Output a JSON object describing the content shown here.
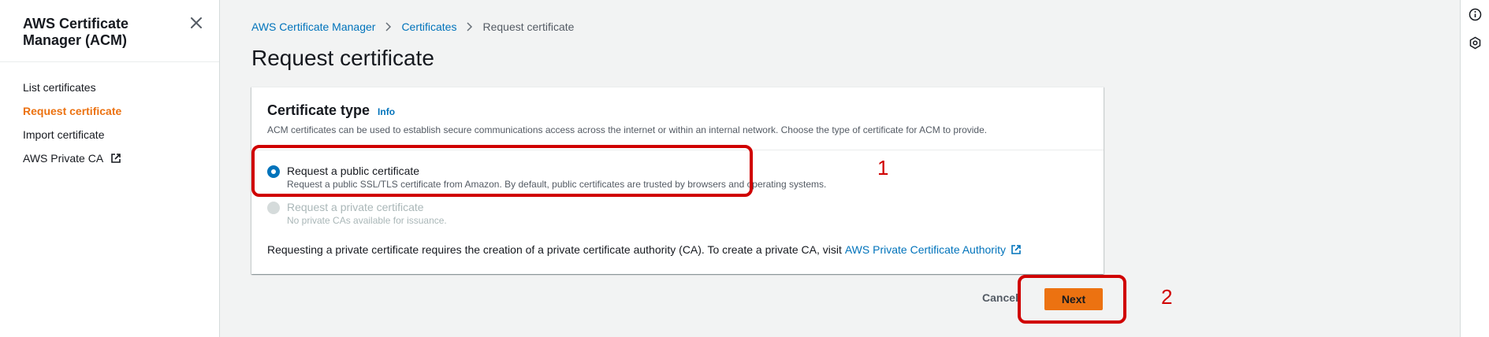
{
  "sidebar": {
    "title": "AWS Certificate Manager (ACM)",
    "items": [
      {
        "label": "List certificates"
      },
      {
        "label": "Request certificate",
        "active": true
      },
      {
        "label": "Import certificate"
      },
      {
        "label": "AWS Private CA",
        "external": true
      }
    ]
  },
  "breadcrumb": {
    "items": [
      "AWS Certificate Manager",
      "Certificates"
    ],
    "current": "Request certificate"
  },
  "page": {
    "title": "Request certificate"
  },
  "certificate_type": {
    "title": "Certificate type",
    "info": "Info",
    "description": "ACM certificates can be used to establish secure communications access across the internet or within an internal network. Choose the type of certificate for ACM to provide.",
    "options": [
      {
        "label": "Request a public certificate",
        "description": "Request a public SSL/TLS certificate from Amazon. By default, public certificates are trusted by browsers and operating systems.",
        "selected": true
      },
      {
        "label": "Request a private certificate",
        "description": "No private CAs available for issuance.",
        "disabled": true
      }
    ],
    "private_note": "Requesting a private certificate requires the creation of a private certificate authority (CA). To create a private CA, visit",
    "private_link": "AWS Private Certificate Authority"
  },
  "actions": {
    "cancel": "Cancel",
    "next": "Next"
  },
  "annotations": [
    "1",
    "2"
  ],
  "colors": {
    "accent": "#ec7211",
    "link": "#0073bb",
    "annotation": "#d00000"
  }
}
